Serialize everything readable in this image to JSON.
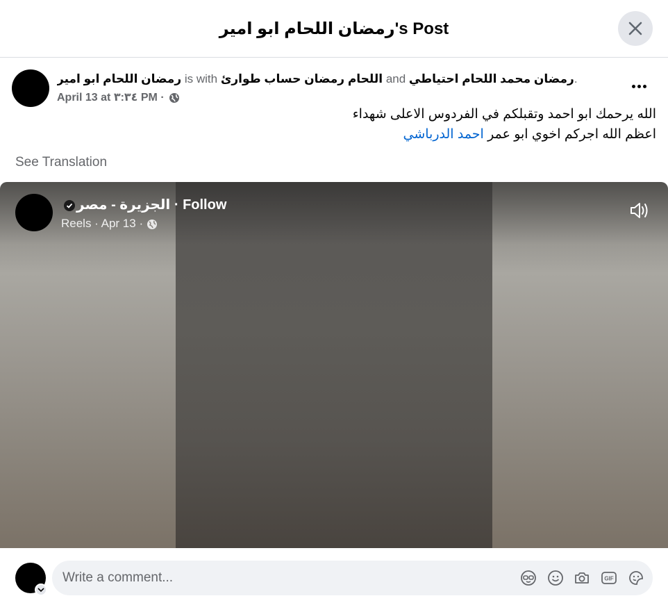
{
  "header": {
    "title": "رمضان اللحام ابو امير's Post",
    "close_icon": "close-icon"
  },
  "post": {
    "author": "رمضان اللحام ابو امير",
    "with_text": "is with",
    "tagged_1": "اللحام رمضان حساب طوارئ",
    "and_text": "and",
    "tagged_2": "رمضان محمد اللحام احتياطي",
    "trailing": ".",
    "date": "April 13 at ٣:٣٤ PM ·",
    "privacy_icon": "globe-icon",
    "more_icon": "more-options-icon",
    "text_line_1": "الله يرحمك ابو احمد وتقبلكم في الفردوس الاعلى شهداء",
    "text_line_2_prefix": "اعظم الله اجركم اخوي ابو عمر ",
    "mention": "احمد الدرباشي",
    "see_translation": "See Translation"
  },
  "video": {
    "page_name": "الجزيرة - مصر",
    "follow": " · Follow",
    "sub": "Reels · Apr 13 ·",
    "sound_icon": "speaker-icon"
  },
  "comment": {
    "placeholder": "Write a comment...",
    "icons": [
      "avatar-sticker-icon",
      "emoji-icon",
      "camera-icon",
      "gif-icon",
      "sticker-icon"
    ]
  },
  "colors": {
    "link": "#0064d1",
    "muted": "#65676b",
    "input_bg": "#f0f2f5",
    "button_bg": "#e4e6eb"
  }
}
